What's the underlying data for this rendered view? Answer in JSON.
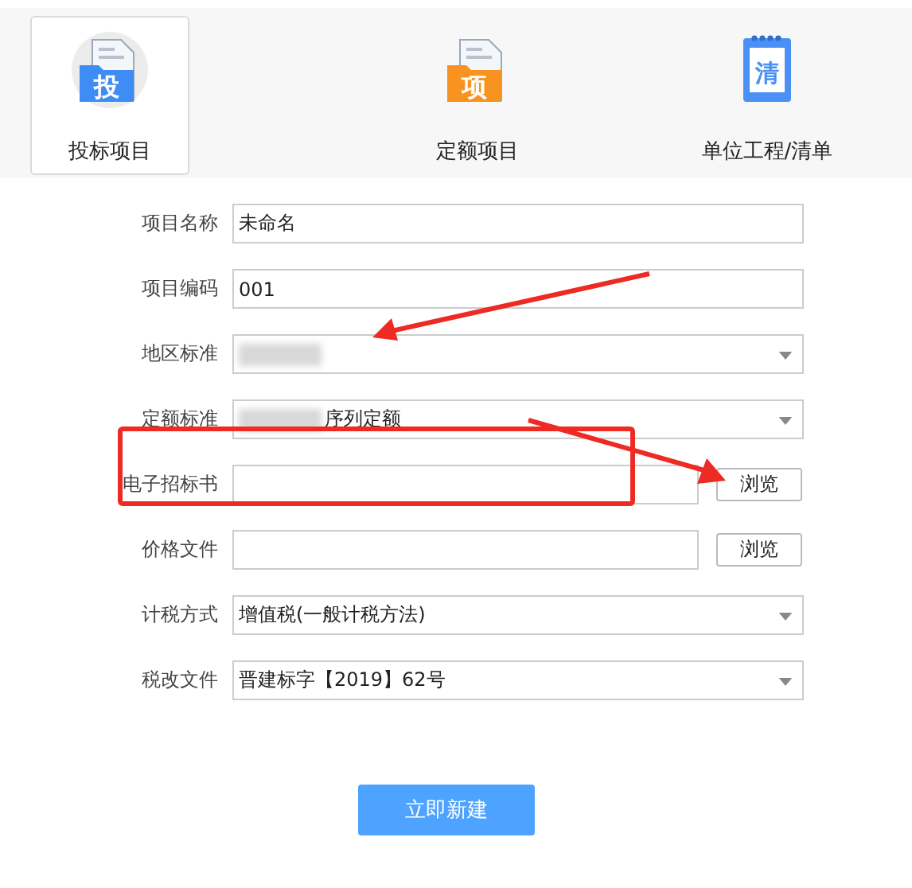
{
  "tabs": [
    {
      "label": "投标项目",
      "icon": "投",
      "kind": "folder-blue",
      "selected": true
    },
    {
      "label": "定额项目",
      "icon": "项",
      "kind": "folder-orange",
      "selected": false
    },
    {
      "label": "单位工程/清单",
      "icon": "清",
      "kind": "notebook",
      "selected": false
    }
  ],
  "fields": [
    {
      "label": "项目名称",
      "kind": "text",
      "value": "未命名"
    },
    {
      "label": "项目编码",
      "kind": "text",
      "value": "001"
    },
    {
      "label": "地区标准",
      "kind": "select",
      "blurred": true
    },
    {
      "label": "定额标准",
      "kind": "select",
      "value": "序列定额",
      "blurred": true
    },
    {
      "label": "电子招标书",
      "kind": "file",
      "button": "浏览"
    },
    {
      "label": "价格文件",
      "kind": "file",
      "button": "浏览"
    },
    {
      "label": "计税方式",
      "kind": "select",
      "value": "增值税(一般计税方法)"
    },
    {
      "label": "税改文件",
      "kind": "select",
      "value": "晋建标字【2019】62号"
    }
  ],
  "submit": "立即新建"
}
